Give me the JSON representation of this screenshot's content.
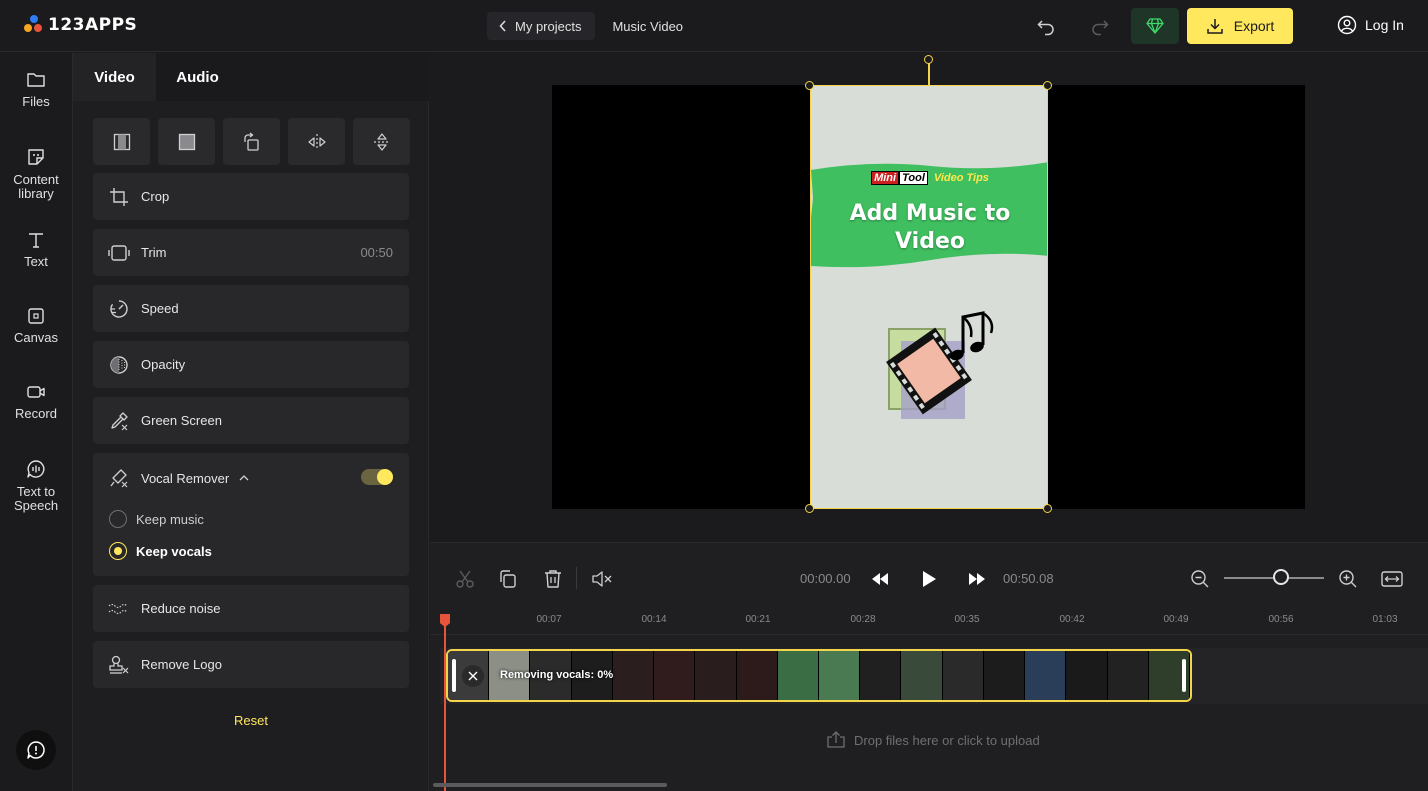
{
  "header": {
    "logo": "123APPS",
    "back_label": "My projects",
    "project_title": "Music Video",
    "export_label": "Export",
    "login_label": "Log In"
  },
  "leftnav": {
    "files": "Files",
    "content_library": "Content library",
    "text": "Text",
    "canvas": "Canvas",
    "record": "Record",
    "tts": "Text to Speech"
  },
  "panel": {
    "tabs": [
      "Video",
      "Audio"
    ],
    "crop": "Crop",
    "trim": "Trim",
    "trim_value": "00:50",
    "speed": "Speed",
    "opacity": "Opacity",
    "green_screen": "Green Screen",
    "vocal_remover": "Vocal Remover",
    "keep_music": "Keep music",
    "keep_vocals": "Keep vocals",
    "reduce_noise": "Reduce noise",
    "remove_logo": "Remove Logo",
    "reset": "Reset"
  },
  "preview": {
    "brand_mini": "Mini",
    "brand_tool": "Tool",
    "brand_tips": "Video Tips",
    "headline": "Add Music to Video"
  },
  "timeline": {
    "current_time": "00:00.00",
    "duration": "00:50.08",
    "ruler": [
      "00:07",
      "00:14",
      "00:21",
      "00:28",
      "00:35",
      "00:42",
      "00:49",
      "00:56",
      "01:03"
    ],
    "clip_status": "Removing vocals: 0%",
    "drop_label": "Drop files here or click to upload"
  },
  "colors": {
    "accent": "#ffe75e",
    "selection": "#f2d54b",
    "playhead": "#e8543b",
    "brand_green": "#3fbf5f"
  }
}
